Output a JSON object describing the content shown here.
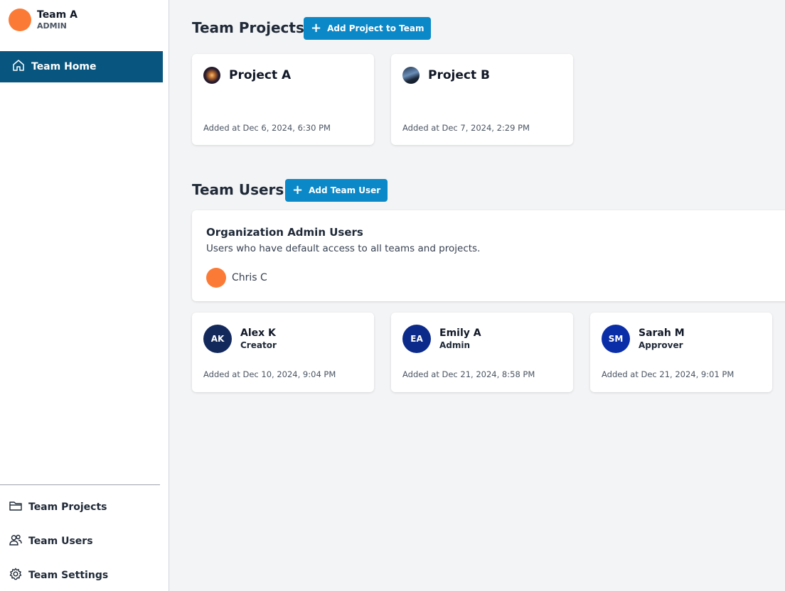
{
  "team": {
    "name": "Team A",
    "role": "ADMIN"
  },
  "sidebar": {
    "active_item": {
      "label": "Team Home",
      "icon": "home-icon"
    },
    "bottom_items": [
      {
        "label": "Team Projects",
        "icon": "folder-icon"
      },
      {
        "label": "Team Users",
        "icon": "users-icon"
      },
      {
        "label": "Team Settings",
        "icon": "gear-icon"
      }
    ]
  },
  "projects_section": {
    "title": "Team Projects",
    "add_button": "Add Project to Team",
    "projects": [
      {
        "name": "Project A",
        "added": "Added at Dec 6, 2024, 6:30 PM"
      },
      {
        "name": "Project B",
        "added": "Added at Dec 7, 2024, 2:29 PM"
      }
    ]
  },
  "users_section": {
    "title": "Team Users",
    "add_button": "Add Team User",
    "org_admins": {
      "title": "Organization Admin Users",
      "description": "Users who have default access to all teams and projects.",
      "users": [
        {
          "name": "Chris C"
        }
      ]
    },
    "users": [
      {
        "initials": "AK",
        "name": "Alex K",
        "role": "Creator",
        "added": "Added at Dec 10, 2024, 9:04 PM",
        "color": "#13295c"
      },
      {
        "initials": "EA",
        "name": "Emily A",
        "role": "Admin",
        "added": "Added at Dec 21, 2024, 8:58 PM",
        "color": "#0b2a8a"
      },
      {
        "initials": "SM",
        "name": "Sarah M",
        "role": "Approver",
        "added": "Added at Dec 21, 2024, 9:01 PM",
        "color": "#0a2ea8"
      }
    ]
  },
  "colors": {
    "accent": "#0b88c7",
    "nav_active": "#08567f",
    "avatar_orange": "#fb7b36"
  }
}
